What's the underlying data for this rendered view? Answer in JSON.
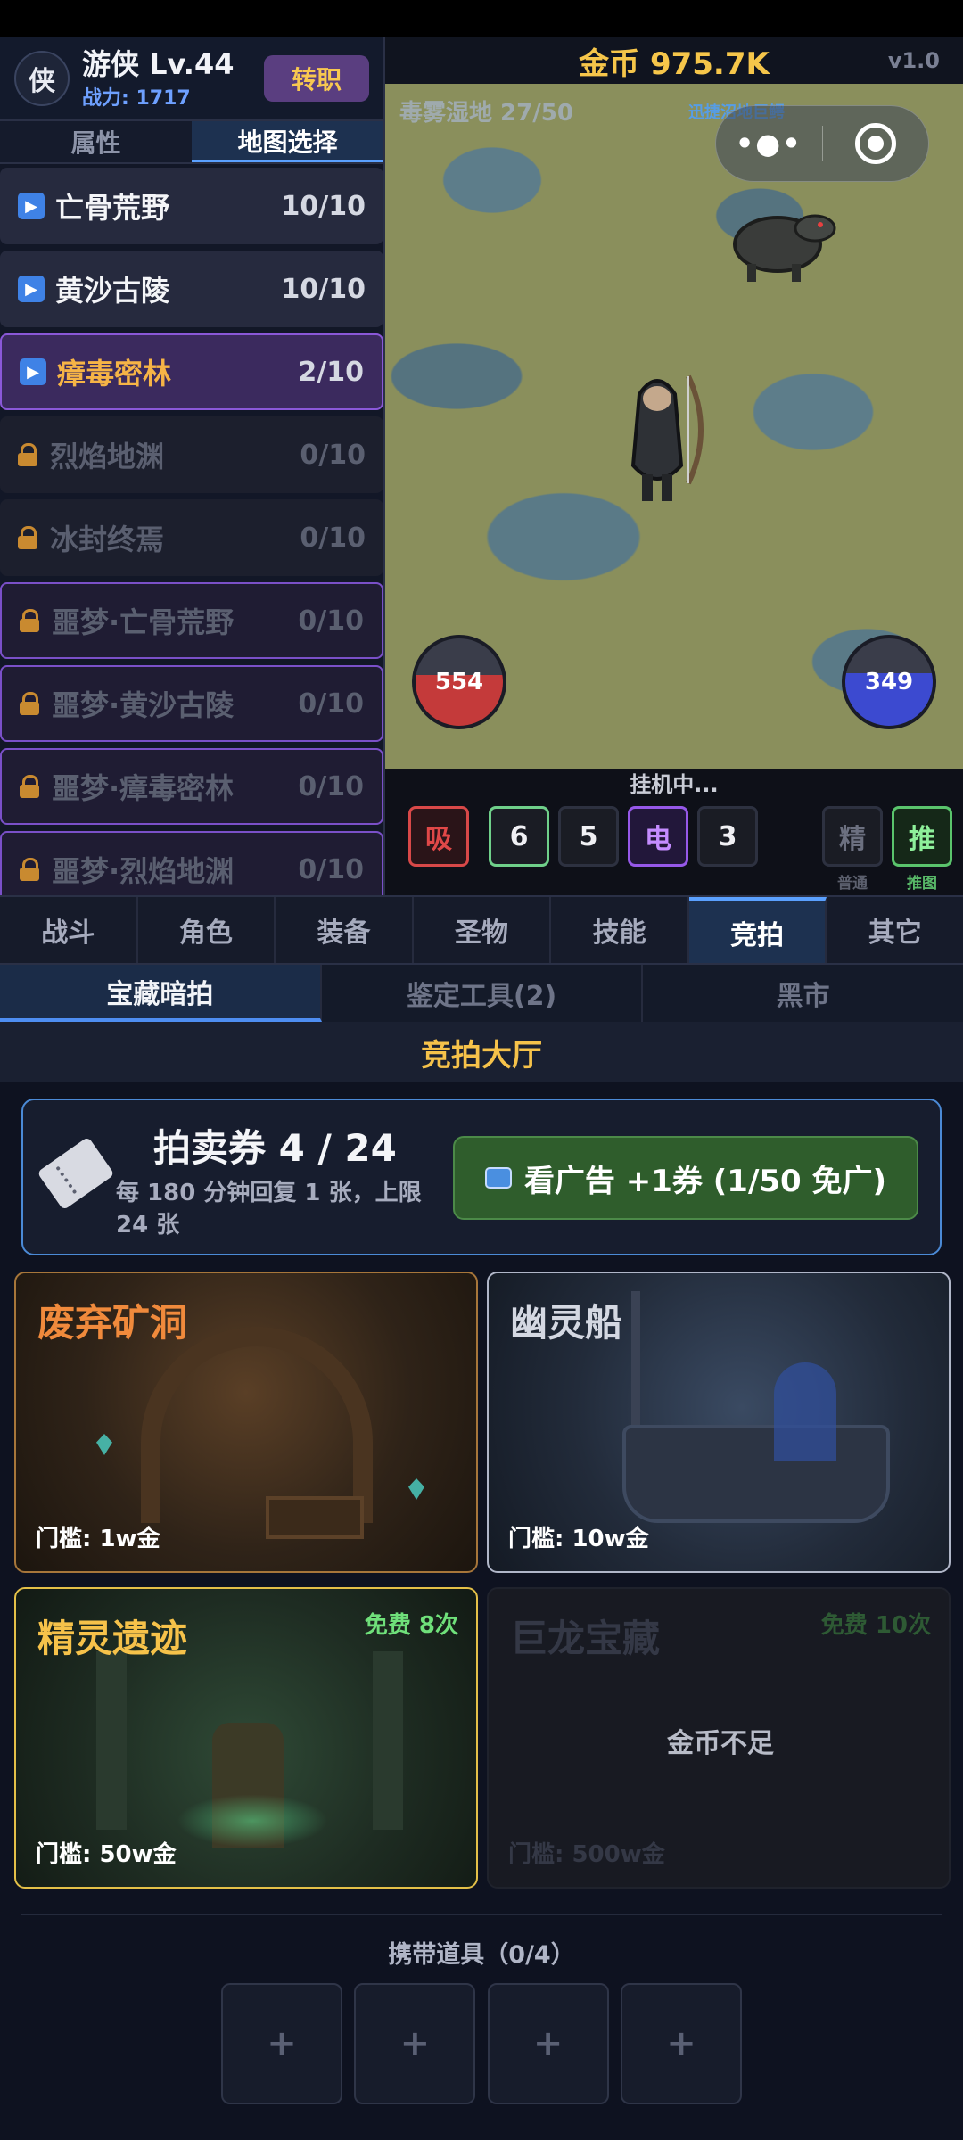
{
  "player": {
    "avatar_char": "侠",
    "name": "游侠 Lv.44",
    "power": "战力: 1717",
    "job_button": "转职"
  },
  "side_tabs": [
    {
      "label": "属性",
      "active": false
    },
    {
      "label": "地图选择",
      "active": true
    }
  ],
  "maps": [
    {
      "name": "亡骨荒野",
      "progress": "10/10",
      "state": "unlocked"
    },
    {
      "name": "黄沙古陵",
      "progress": "10/10",
      "state": "unlocked"
    },
    {
      "name": "瘴毒密林",
      "progress": "2/10",
      "state": "selected"
    },
    {
      "name": "烈焰地渊",
      "progress": "0/10",
      "state": "locked"
    },
    {
      "name": "冰封终焉",
      "progress": "0/10",
      "state": "locked"
    },
    {
      "name": "噩梦·亡骨荒野",
      "progress": "0/10",
      "state": "nightmare"
    },
    {
      "name": "噩梦·黄沙古陵",
      "progress": "0/10",
      "state": "nightmare"
    },
    {
      "name": "噩梦·瘴毒密林",
      "progress": "0/10",
      "state": "nightmare"
    },
    {
      "name": "噩梦·烈焰地渊",
      "progress": "0/10",
      "state": "nightmare"
    }
  ],
  "scene": {
    "gold": "金币 975.7K",
    "version": "v1.0",
    "zone": "毒雾湿地 27/50",
    "boss_hint": "迅捷沼地巨鳄",
    "hp": "554",
    "mp": "349",
    "idle_status": "挂机中..."
  },
  "skills": {
    "absorb": "吸",
    "s6": "6",
    "s5": "5",
    "elec": "电",
    "s3": "3",
    "elite": "精",
    "elite_caption": "普通",
    "push": "推",
    "push_caption": "推图"
  },
  "main_tabs": [
    {
      "label": "战斗",
      "active": false
    },
    {
      "label": "角色",
      "active": false
    },
    {
      "label": "装备",
      "active": false
    },
    {
      "label": "圣物",
      "active": false
    },
    {
      "label": "技能",
      "active": false
    },
    {
      "label": "竞拍",
      "active": true
    },
    {
      "label": "其它",
      "active": false
    }
  ],
  "sub_tabs": [
    {
      "label": "宝藏暗拍",
      "active": true
    },
    {
      "label": "鉴定工具(2)",
      "active": false
    },
    {
      "label": "黑市",
      "active": false
    }
  ],
  "hall_title": "竞拍大厅",
  "ticket": {
    "title": "拍卖券 4 / 24",
    "desc": "每 180 分钟回复 1 张，上限 24 张",
    "ad_button": "看广告 +1券 (1/50 免广)"
  },
  "treasures": [
    {
      "name": "废弃矿洞",
      "min": "门槛: 1w金"
    },
    {
      "name": "幽灵船",
      "min": "门槛: 10w金"
    },
    {
      "name": "精灵遗迹",
      "min": "门槛: 50w金",
      "free": "免费 8次"
    },
    {
      "name": "巨龙宝藏",
      "min": "门槛: 500w金",
      "free": "免费 10次",
      "status": "金币不足"
    }
  ],
  "carry": {
    "title": "携带道具（0/4）",
    "slot_symbol": "+"
  },
  "colors": {
    "accent_blue": "#5aa0ff",
    "gold": "#f6c24a",
    "selected_purple": "#8a58d8",
    "ad_green": "#2f5d2c"
  }
}
